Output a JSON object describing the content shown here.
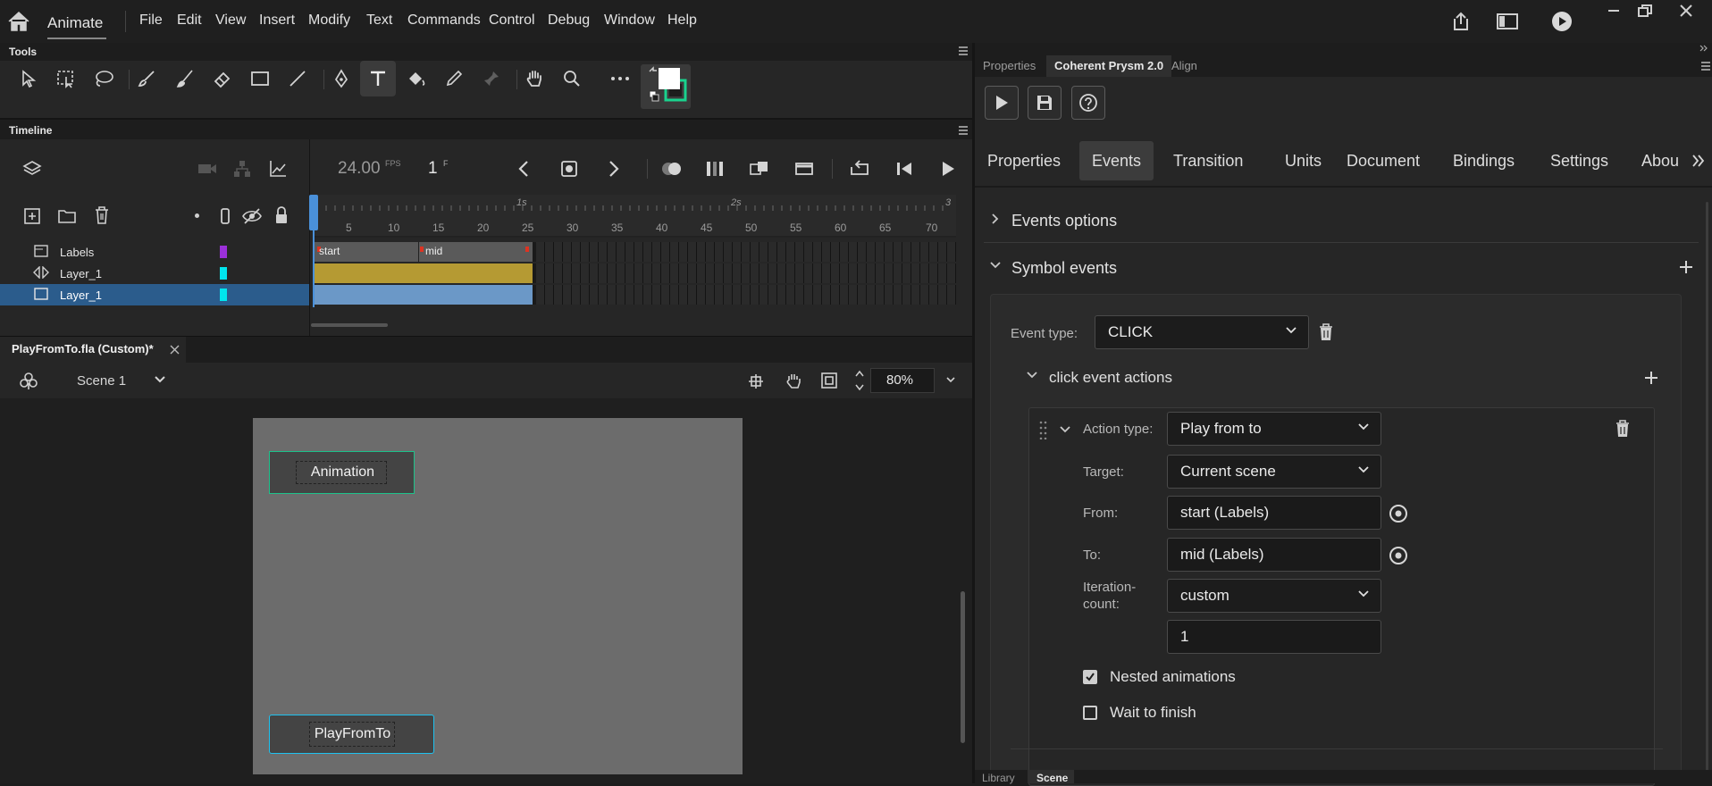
{
  "app": {
    "name": "Animate"
  },
  "menus": [
    "File",
    "Edit",
    "View",
    "Insert",
    "Modify",
    "Text",
    "Commands",
    "Control",
    "Debug",
    "Window",
    "Help"
  ],
  "tools_panel": {
    "title": "Tools"
  },
  "timeline": {
    "title": "Timeline",
    "fps": "24.00",
    "fps_unit": "FPS",
    "frame": "1",
    "frame_unit": "F",
    "seconds_markers": [
      "1s",
      "2s",
      "3"
    ],
    "frame_numbers": [
      "5",
      "10",
      "15",
      "20",
      "25",
      "30",
      "35",
      "40",
      "45",
      "50",
      "55",
      "60",
      "65",
      "70"
    ],
    "layers": [
      {
        "name": "Labels",
        "color": "#9b30d9"
      },
      {
        "name": "Layer_1",
        "color": "#00e5ee"
      },
      {
        "name": "Layer_1",
        "color": "#00e5ee",
        "selected": true
      }
    ],
    "frame_labels": [
      "start",
      "mid"
    ]
  },
  "document": {
    "tab_title": "PlayFromTo.fla (Custom)*",
    "scene": "Scene 1",
    "zoom": "80%"
  },
  "stage": {
    "buttons": [
      "Animation",
      "PlayFromTo"
    ]
  },
  "right_panel": {
    "top_tabs": [
      "Properties",
      "Coherent Prysm 2.0",
      "Align"
    ],
    "nav_tabs": [
      "Properties",
      "Events",
      "Transition",
      "Units",
      "Document",
      "Bindings",
      "Settings",
      "Abou"
    ],
    "sections": {
      "events_options": "Events options",
      "symbol_events": "Symbol events"
    },
    "event": {
      "type_label": "Event type:",
      "type_value": "CLICK",
      "actions_title": "click event actions",
      "action_type_label": "Action type:",
      "action_type_value": "Play from to",
      "target_label": "Target:",
      "target_value": "Current scene",
      "from_label": "From:",
      "from_value": "start (Labels)",
      "to_label": "To:",
      "to_value": "mid (Labels)",
      "iteration_label_1": "Iteration-",
      "iteration_label_2": "count:",
      "iteration_value": "custom",
      "iteration_number": "1",
      "nested_label": "Nested animations",
      "nested_checked": true,
      "wait_label": "Wait to finish",
      "wait_checked": false
    },
    "bottom_tabs": [
      "Library",
      "Scene"
    ]
  }
}
